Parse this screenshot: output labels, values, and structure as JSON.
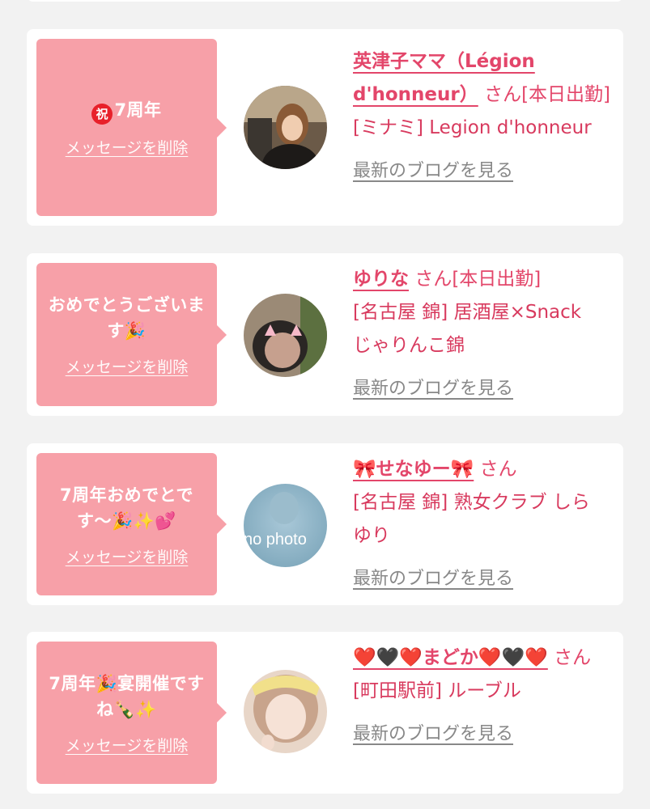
{
  "items": [
    {
      "message_prefix": "祝",
      "message": "7周年",
      "delete_label": "メッセージを削除",
      "name": "英津子ママ（Légion d'honneur）",
      "san_status": "さん[本日出勤]",
      "shop": "[ミナミ] Legion d'honneur",
      "blog_label": "最新のブログを見る"
    },
    {
      "message": "おめでとうございます🎉",
      "delete_label": "メッセージを削除",
      "name": "ゆりな",
      "san_status": "さん[本日出勤]",
      "shop": "[名古屋 錦] 居酒屋×Snack じゃりんこ錦",
      "blog_label": "最新のブログを見る"
    },
    {
      "message": "7周年おめでとです〜🎉✨💕",
      "delete_label": "メッセージを削除",
      "name": "🎀せなゆー🎀",
      "san_status": "さん",
      "shop": "[名古屋 錦] 熟女クラブ しらゆり",
      "blog_label": "最新のブログを見る",
      "avatar_text": "no photo"
    },
    {
      "message": "7周年🎉宴開催ですね🍾✨",
      "delete_label": "メッセージを削除",
      "name": "❤️🖤❤️まどか❤️🖤❤️",
      "san_status": "さん",
      "shop": "[町田駅前] ルーブル",
      "blog_label": "最新のブログを見る"
    }
  ],
  "colors": {
    "bubble": "#f7a0a8",
    "name": "#e3466a",
    "shop": "#d83a5e",
    "link_gray": "#888888",
    "background": "#f2f2f2"
  }
}
